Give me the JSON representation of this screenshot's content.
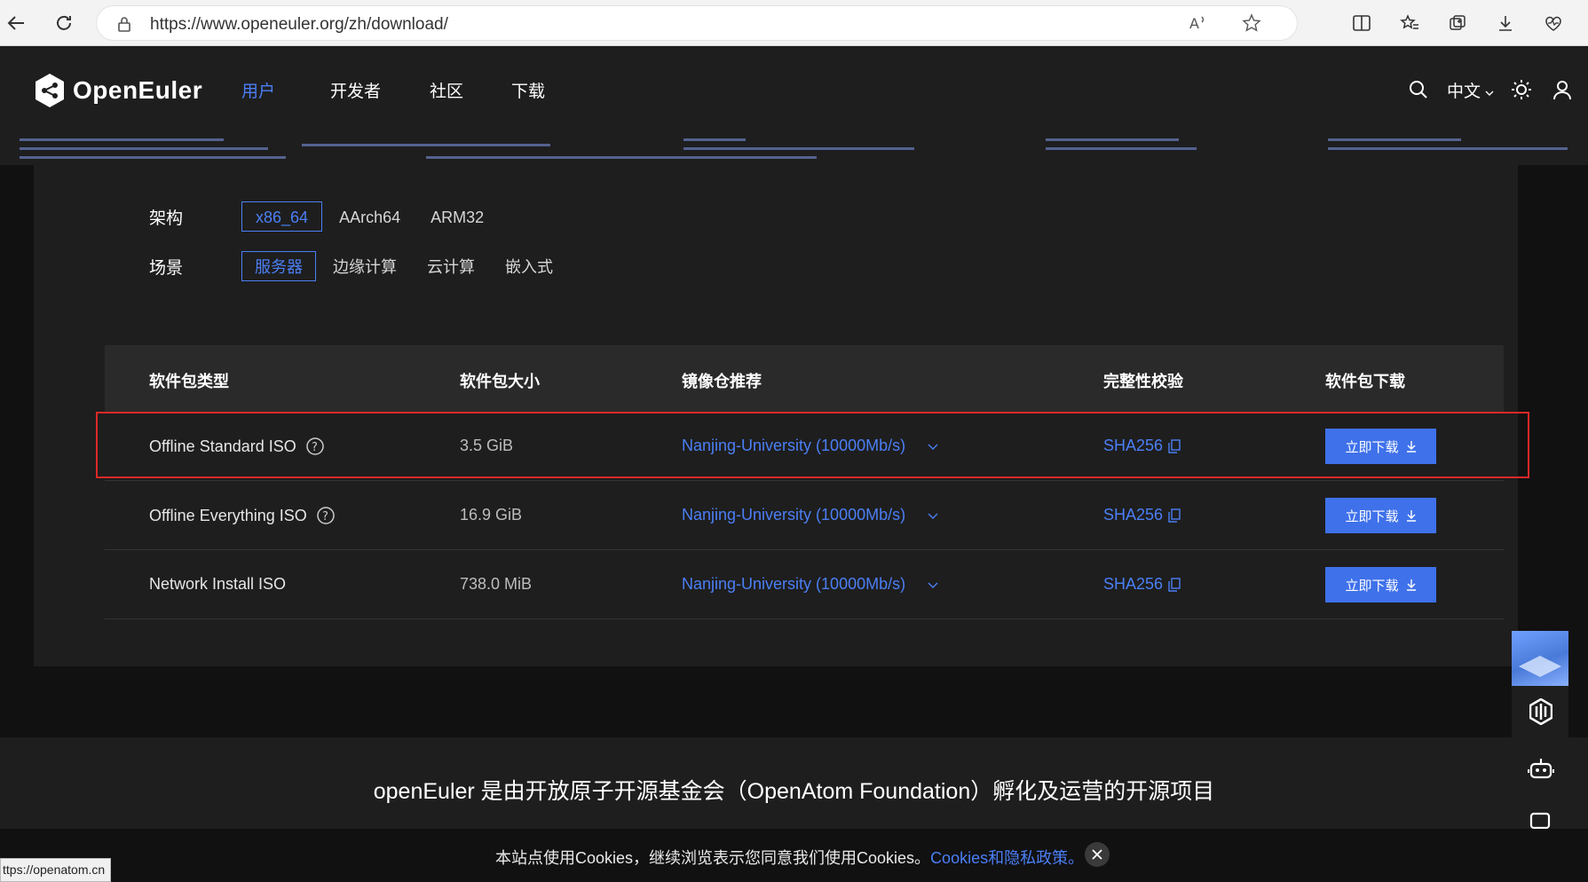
{
  "browser": {
    "url": "https://www.openeuler.org/zh/download/"
  },
  "header": {
    "logo_text": "OpenEuler",
    "nav": [
      {
        "label": "用户"
      },
      {
        "label": "开发者"
      },
      {
        "label": "社区"
      },
      {
        "label": "下载"
      }
    ],
    "lang": "中文"
  },
  "filters": {
    "arch_label": "架构",
    "arch_options": [
      "x86_64",
      "AArch64",
      "ARM32"
    ],
    "scene_label": "场景",
    "scene_options": [
      "服务器",
      "边缘计算",
      "云计算",
      "嵌入式"
    ]
  },
  "table": {
    "headers": [
      "软件包类型",
      "软件包大小",
      "镜像仓推荐",
      "完整性校验",
      "软件包下载"
    ],
    "rows": [
      {
        "type": "Offline Standard ISO",
        "size": "3.5 GiB",
        "mirror": "Nanjing-University (10000Mb/s)",
        "checksum": "SHA256",
        "download": "立即下载"
      },
      {
        "type": "Offline Everything ISO",
        "size": "16.9 GiB",
        "mirror": "Nanjing-University (10000Mb/s)",
        "checksum": "SHA256",
        "download": "立即下载"
      },
      {
        "type": "Network Install ISO",
        "size": "738.0 MiB",
        "mirror": "Nanjing-University (10000Mb/s)",
        "checksum": "SHA256",
        "download": "立即下载"
      }
    ]
  },
  "footer": {
    "text": "openEuler 是由开放原子开源基金会（OpenAtom Foundation）孵化及运营的开源项目"
  },
  "cookie": {
    "text": "本站点使用Cookies，继续浏览表示您同意我们使用Cookies。",
    "link": "Cookies和隐私政策。"
  },
  "status_url": "ttps://openatom.cn",
  "colors": {
    "accent": "#4b7ff5",
    "button": "#3f71ea",
    "highlight": "#e02828"
  }
}
